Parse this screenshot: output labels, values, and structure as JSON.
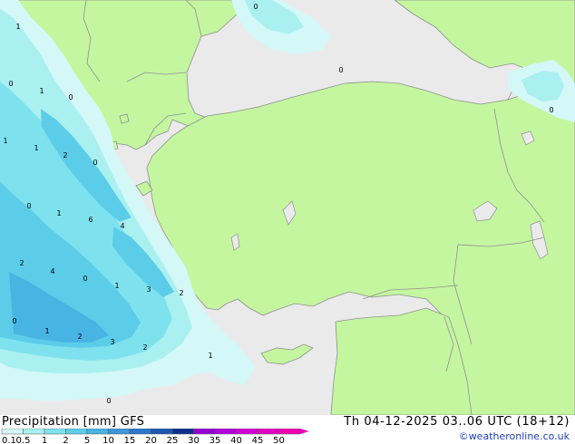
{
  "header": {
    "product_label": "Precipitation [mm]",
    "model": "GFS",
    "valid_time": "Th 04-12-2025 03..06 UTC (18+12)",
    "credit": "©weatheronline.co.uk"
  },
  "legend": {
    "levels": [
      "0.1",
      "0.5",
      "1",
      "2",
      "5",
      "10",
      "15",
      "20",
      "25",
      "30",
      "35",
      "40",
      "45",
      "50"
    ],
    "colors": [
      "#d4f7f7",
      "#aaf0f0",
      "#7ee2ee",
      "#5ccde8",
      "#48b4e4",
      "#3c96dc",
      "#2c76cc",
      "#1c56b4",
      "#0c2f8c",
      "#9400d4",
      "#b400dc",
      "#d000d4",
      "#e400c4",
      "#f000b4"
    ]
  },
  "map": {
    "land_color": "#c4f6a0",
    "sea_color": "#eaeaea",
    "border_color": "#8f8f8f",
    "contour_labels": [
      {
        "text": "1"
      },
      {
        "text": "0"
      },
      {
        "text": "0"
      },
      {
        "text": "0"
      },
      {
        "text": "1"
      },
      {
        "text": "0"
      },
      {
        "text": "1"
      },
      {
        "text": "1"
      },
      {
        "text": "2"
      },
      {
        "text": "0"
      },
      {
        "text": "0"
      },
      {
        "text": "1"
      },
      {
        "text": "6"
      },
      {
        "text": "4"
      },
      {
        "text": "2"
      },
      {
        "text": "4"
      },
      {
        "text": "0"
      },
      {
        "text": "1"
      },
      {
        "text": "3"
      },
      {
        "text": "2"
      },
      {
        "text": "0"
      },
      {
        "text": "1"
      },
      {
        "text": "2"
      },
      {
        "text": "3"
      },
      {
        "text": "2"
      },
      {
        "text": "1"
      },
      {
        "text": "0"
      },
      {
        "text": "0"
      }
    ]
  }
}
